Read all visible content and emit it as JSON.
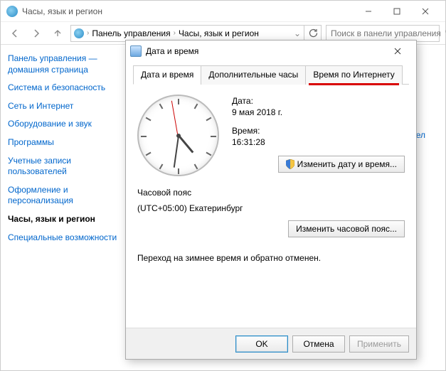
{
  "window": {
    "title": "Часы, язык и регион"
  },
  "breadcrumb": {
    "item1": "Панель управления",
    "item2": "Часы, язык и регион"
  },
  "search": {
    "placeholder": "Поиск в панели управления"
  },
  "sidebar": {
    "home1": "Панель управления —",
    "home2": "домашняя страница",
    "items": [
      "Система и безопасность",
      "Сеть и Интернет",
      "Оборудование и звук",
      "Программы",
      "Учетные записи пользователей",
      "Оформление и персонализация",
      "Часы, язык и регион",
      "Специальные возможности"
    ],
    "current_index": 6
  },
  "main": {
    "peek_link": "ени и чисел"
  },
  "dialog": {
    "title": "Дата и время",
    "tabs": [
      "Дата и время",
      "Дополнительные часы",
      "Время по Интернету"
    ],
    "active_tab": 0,
    "highlight_tab": 2,
    "date_label": "Дата:",
    "date_value": "9 мая 2018 г.",
    "time_label": "Время:",
    "time_value": "16:31:28",
    "change_dt_btn": "Изменить дату и время...",
    "tz_label": "Часовой пояс",
    "tz_value": "(UTC+05:00) Екатеринбург",
    "change_tz_btn": "Изменить часовой пояс...",
    "dst_msg": "Переход на зимнее время и обратно отменен.",
    "ok": "OK",
    "cancel": "Отмена",
    "apply": "Применить"
  }
}
